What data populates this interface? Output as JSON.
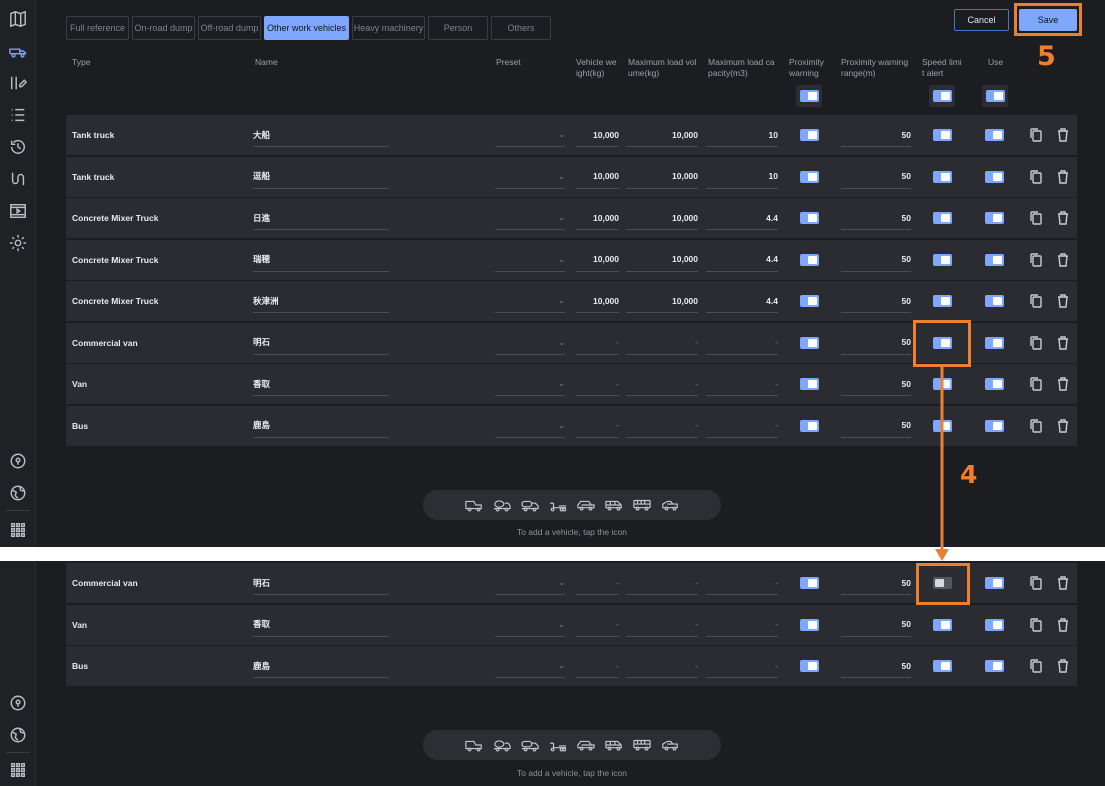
{
  "tabs": [
    {
      "label": "Full reference",
      "active": false
    },
    {
      "label": "On-road dump",
      "active": false
    },
    {
      "label": "Off-road dump",
      "active": false
    },
    {
      "label": "Other work vehicles",
      "active": true
    },
    {
      "label": "Heavy machinery",
      "active": false
    },
    {
      "label": "Person",
      "active": false
    },
    {
      "label": "Others",
      "active": false
    }
  ],
  "actions": {
    "cancel": "Cancel",
    "save": "Save"
  },
  "annotations": {
    "step5": "5",
    "step4": "4"
  },
  "columns": {
    "type": "Type",
    "name": "Name",
    "preset": "Preset",
    "vehicle_weight": "Vehicle we ight(kg)",
    "max_load_volume": "Maximum load vol ume(kg)",
    "max_load_capacity": "Maximum load ca pacity(m3)",
    "proximity_warning": "Proximity warning",
    "proximity_warning_range": "Proximity warning range(m)",
    "speed_limit_alert": "Speed limi t alert",
    "use": "Use"
  },
  "header_toggles": {
    "proximity_warning": true,
    "speed_limit_alert": true,
    "use": true
  },
  "rows": [
    {
      "type": "Tank truck",
      "name": "大船",
      "preset": "",
      "weight": "10,000",
      "volume": "10,000",
      "capacity": "10",
      "proximity": true,
      "range": "50",
      "speed": true,
      "use": true
    },
    {
      "type": "Tank truck",
      "name": "逗船",
      "preset": "",
      "weight": "10,000",
      "volume": "10,000",
      "capacity": "10",
      "proximity": true,
      "range": "50",
      "speed": true,
      "use": true
    },
    {
      "type": "Concrete Mixer Truck",
      "name": "日進",
      "preset": "",
      "weight": "10,000",
      "volume": "10,000",
      "capacity": "4.4",
      "proximity": true,
      "range": "50",
      "speed": true,
      "use": true
    },
    {
      "type": "Concrete Mixer Truck",
      "name": "瑞穂",
      "preset": "",
      "weight": "10,000",
      "volume": "10,000",
      "capacity": "4.4",
      "proximity": true,
      "range": "50",
      "speed": true,
      "use": true
    },
    {
      "type": "Concrete Mixer Truck",
      "name": "秋津洲",
      "preset": "",
      "weight": "10,000",
      "volume": "10,000",
      "capacity": "4.4",
      "proximity": true,
      "range": "50",
      "speed": true,
      "use": true
    },
    {
      "type": "Commercial van",
      "name": "明石",
      "preset": "",
      "weight": "-",
      "volume": "-",
      "capacity": "-",
      "proximity": true,
      "range": "50",
      "speed": true,
      "use": true
    },
    {
      "type": "Van",
      "name": "香取",
      "preset": "",
      "weight": "-",
      "volume": "-",
      "capacity": "-",
      "proximity": true,
      "range": "50",
      "speed": true,
      "use": true
    },
    {
      "type": "Bus",
      "name": "鹿島",
      "preset": "",
      "weight": "-",
      "volume": "-",
      "capacity": "-",
      "proximity": true,
      "range": "50",
      "speed": true,
      "use": true
    }
  ],
  "rows_after": [
    {
      "type": "Commercial van",
      "name": "明石",
      "preset": "",
      "weight": "-",
      "volume": "-",
      "capacity": "-",
      "proximity": true,
      "range": "50",
      "speed": false,
      "use": true
    },
    {
      "type": "Van",
      "name": "香取",
      "preset": "",
      "weight": "-",
      "volume": "-",
      "capacity": "-",
      "proximity": true,
      "range": "50",
      "speed": true,
      "use": true
    },
    {
      "type": "Bus",
      "name": "鹿島",
      "preset": "",
      "weight": "-",
      "volume": "-",
      "capacity": "-",
      "proximity": true,
      "range": "50",
      "speed": true,
      "use": true
    }
  ],
  "add_hint": "To add a vehicle, tap the icon",
  "vehicle_icons": [
    "dump-truck-icon",
    "mixer-truck-icon",
    "tank-truck-icon",
    "trailer-icon",
    "car-icon",
    "van-icon",
    "bus-icon",
    "truck-icon"
  ],
  "colors": {
    "accent": "#7ea7ff",
    "annotation": "#ee7f30",
    "background": "#1c1d21",
    "row": "#2a2c31"
  }
}
